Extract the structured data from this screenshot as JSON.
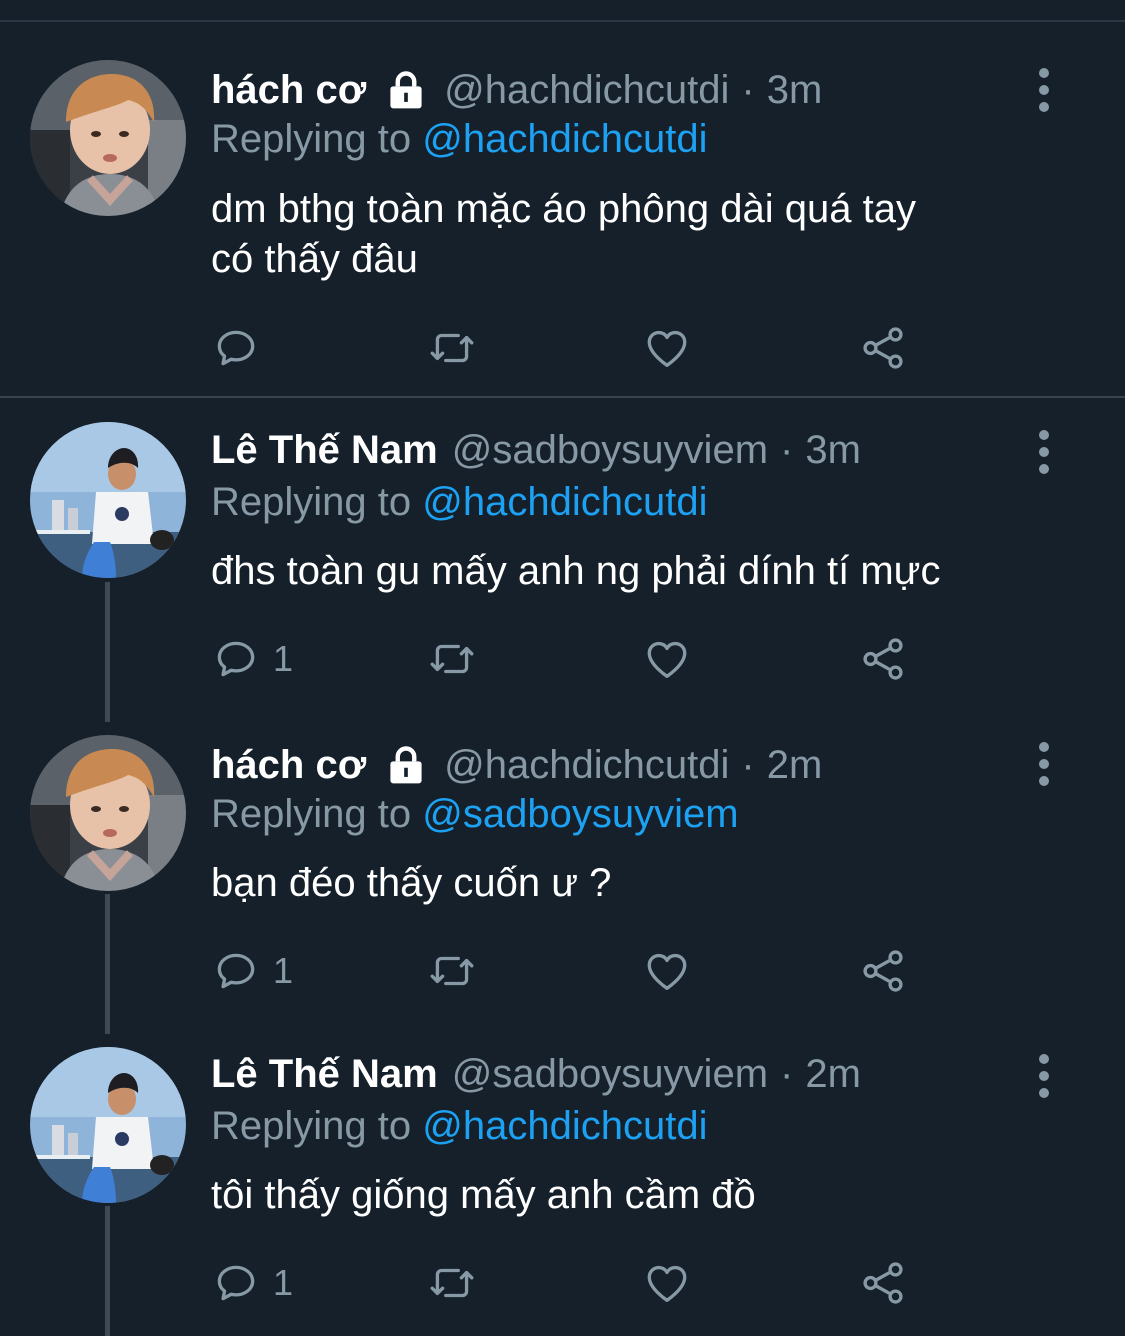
{
  "colors": {
    "background": "#15202b",
    "text": "#ffffff",
    "muted": "#8899a6",
    "link": "#1da1f2",
    "divider": "#38444d"
  },
  "tweets": [
    {
      "name": "hách cơ",
      "protected": true,
      "handle": "@hachdichcutdi",
      "time": "3m",
      "replying_label": "Replying to",
      "replying_to": "@hachdichcutdi",
      "text_lines": [
        "dm bthg toàn mặc áo phông dài quá tay",
        "có thấy đâu"
      ],
      "reply_count": "",
      "avatar": "avatar-hachco"
    },
    {
      "name": "Lê Thế Nam",
      "protected": false,
      "handle": "@sadboysuyviem",
      "time": "3m",
      "replying_label": "Replying to",
      "replying_to": "@hachdichcutdi",
      "text_lines": [
        "đhs toàn gu mấy anh ng phải dính tí mực"
      ],
      "reply_count": "1",
      "avatar": "avatar-lethenam"
    },
    {
      "name": "hách cơ",
      "protected": true,
      "handle": "@hachdichcutdi",
      "time": "2m",
      "replying_label": "Replying to",
      "replying_to": "@sadboysuyviem",
      "text_lines": [
        "bạn đéo thấy cuốn ư ?"
      ],
      "reply_count": "1",
      "avatar": "avatar-hachco"
    },
    {
      "name": "Lê Thế Nam",
      "protected": false,
      "handle": "@sadboysuyviem",
      "time": "2m",
      "replying_label": "Replying to",
      "replying_to": "@hachdichcutdi",
      "text_lines": [
        "tôi thấy giống mấy anh cầm đồ"
      ],
      "reply_count": "1",
      "avatar": "avatar-lethenam"
    }
  ],
  "separator": "·",
  "icons": [
    "lock-icon",
    "more-icon",
    "reply-icon",
    "retweet-icon",
    "like-icon",
    "share-icon"
  ]
}
